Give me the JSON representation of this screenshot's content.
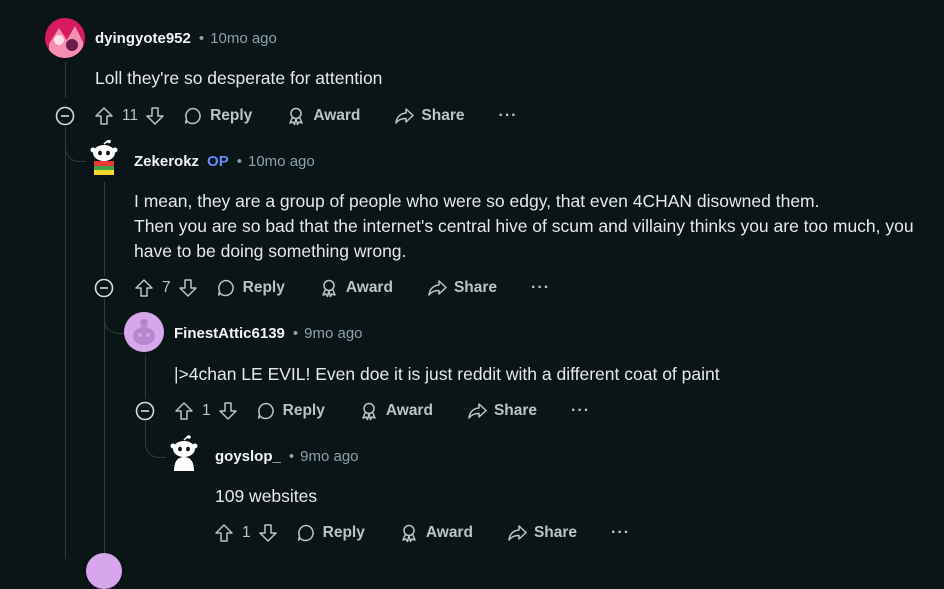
{
  "comments": [
    {
      "username": "dyingyote952",
      "time": "10mo ago",
      "text": [
        "Loll they're so desperate for attention"
      ],
      "votes": "11"
    },
    {
      "username": "Zekerokz",
      "op": "OP",
      "time": "10mo ago",
      "text": [
        "I mean, they are a group of people who were so edgy, that even 4CHAN disowned them.",
        "Then you are so bad that the internet's central hive of scum and villainy thinks you are too much, you",
        "have to be doing something wrong."
      ],
      "votes": "7"
    },
    {
      "username": "FinestAttic6139",
      "time": "9mo ago",
      "text": [
        "|>4chan LE EVIL! Even doe it is just reddit with a different coat of paint"
      ],
      "votes": "1"
    },
    {
      "username": "goyslop_",
      "time": "9mo ago",
      "text": [
        "109 websites"
      ],
      "votes": "1"
    }
  ],
  "separator": "•",
  "actions": {
    "reply": "Reply",
    "award": "Award",
    "share": "Share",
    "more": "···"
  },
  "colors": {
    "background": "#0b1416",
    "op": "#648efc",
    "meta": "#8ba2ad"
  }
}
